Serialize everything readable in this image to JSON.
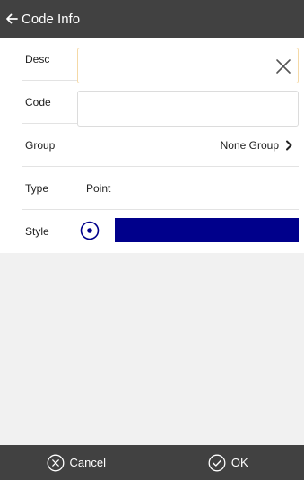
{
  "header": {
    "title": "Code Info",
    "back_icon": "arrow-left-icon"
  },
  "form": {
    "desc": {
      "label": "Desc",
      "value": "",
      "clear_icon": "close-icon"
    },
    "code": {
      "label": "Code",
      "value": ""
    },
    "group": {
      "label": "Group",
      "value": "None Group",
      "icon": "chevron-right-icon"
    },
    "type": {
      "label": "Type",
      "value": "Point"
    },
    "style": {
      "label": "Style",
      "icon": "radio-selected-icon",
      "color": "#00008b"
    }
  },
  "footer": {
    "cancel_label": "Cancel",
    "cancel_icon": "close-circle-icon",
    "ok_label": "OK",
    "ok_icon": "check-circle-icon"
  }
}
